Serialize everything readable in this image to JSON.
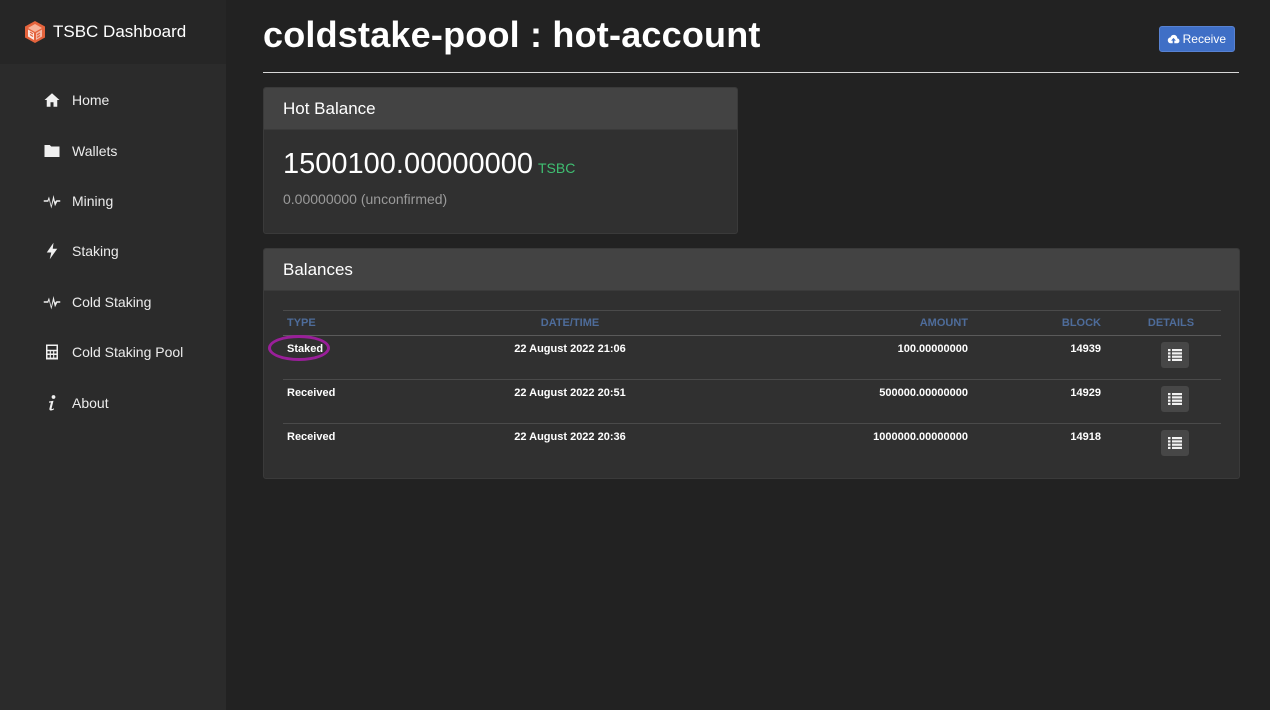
{
  "sidebar": {
    "brand": "TSBC Dashboard",
    "items": [
      {
        "label": "Home",
        "icon": "home-icon"
      },
      {
        "label": "Wallets",
        "icon": "folder-icon"
      },
      {
        "label": "Mining",
        "icon": "pulse-icon"
      },
      {
        "label": "Staking",
        "icon": "bolt-icon"
      },
      {
        "label": "Cold Staking",
        "icon": "pulse-icon"
      },
      {
        "label": "Cold Staking Pool",
        "icon": "calculator-icon"
      },
      {
        "label": "About",
        "icon": "info-icon"
      }
    ]
  },
  "header": {
    "title": "coldstake-pool : hot-account",
    "receive_label": "Receive"
  },
  "hot_balance": {
    "heading": "Hot Balance",
    "amount": "1500100.00000000",
    "unit": "TSBC",
    "unconfirmed": "0.00000000 (unconfirmed)"
  },
  "balances": {
    "heading": "Balances",
    "columns": {
      "type": "TYPE",
      "datetime": "DATE/TIME",
      "amount": "AMOUNT",
      "block": "BLOCK",
      "details": "DETAILS"
    },
    "rows": [
      {
        "type": "Staked",
        "datetime": "22 August 2022 21:06",
        "amount": "100.00000000",
        "block": "14939"
      },
      {
        "type": "Received",
        "datetime": "22 August 2022 20:51",
        "amount": "500000.00000000",
        "block": "14929"
      },
      {
        "type": "Received",
        "datetime": "22 August 2022 20:36",
        "amount": "1000000.00000000",
        "block": "14918"
      }
    ]
  },
  "colors": {
    "accent": "#3f6fc6",
    "unit_green": "#3fbf72",
    "header_blue": "#4e6c9a",
    "highlight": "#9a1f9a"
  }
}
